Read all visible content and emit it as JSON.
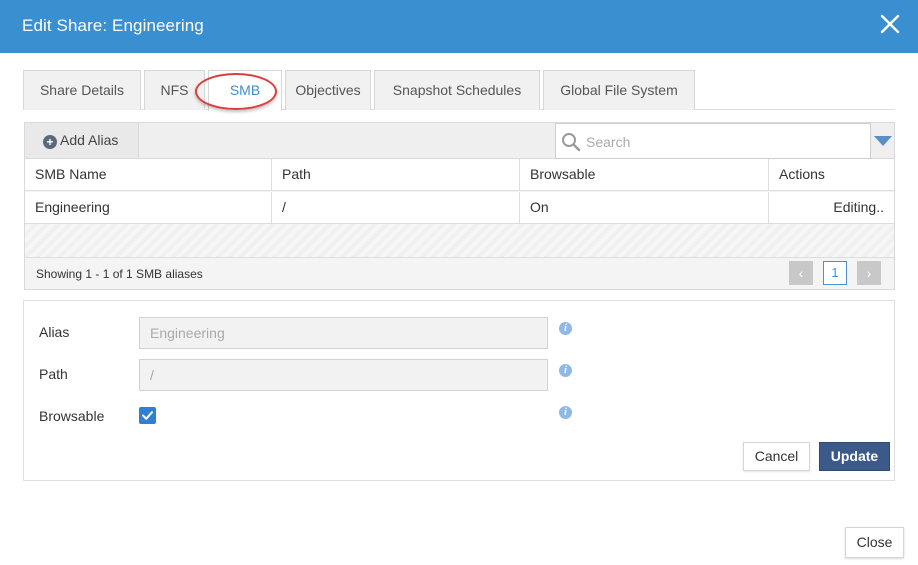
{
  "dialog": {
    "title": "Edit Share: Engineering",
    "accent_color": "#3a8fd1"
  },
  "tabs": [
    {
      "label": "Share Details",
      "active": false
    },
    {
      "label": "NFS",
      "active": false
    },
    {
      "label": "SMB",
      "active": true
    },
    {
      "label": "Objectives",
      "active": false
    },
    {
      "label": "Snapshot Schedules",
      "active": false
    },
    {
      "label": "Global File System",
      "active": false
    }
  ],
  "grid": {
    "add_alias_label": "Add Alias",
    "search_placeholder": "Search",
    "columns": [
      "SMB Name",
      "Path",
      "Browsable",
      "Actions"
    ],
    "rows": [
      {
        "smb_name": "Engineering",
        "path": "/",
        "browsable": "On",
        "actions": "Editing.."
      }
    ],
    "pager": {
      "info": "Showing 1 - 1 of 1 SMB aliases",
      "current_page": "1"
    }
  },
  "form": {
    "alias_label": "Alias",
    "alias_value": "Engineering",
    "path_label": "Path",
    "path_value": "/",
    "browsable_label": "Browsable",
    "browsable_checked": true,
    "cancel_label": "Cancel",
    "update_label": "Update"
  },
  "footer": {
    "close_label": "Close"
  },
  "icons": {
    "close": "close-icon",
    "search": "search-icon",
    "plus": "plus-circle-icon",
    "info": "info-icon",
    "dropdown": "caret-down-icon",
    "prev": "chevron-left-icon",
    "next": "chevron-right-icon",
    "check": "check-icon"
  }
}
